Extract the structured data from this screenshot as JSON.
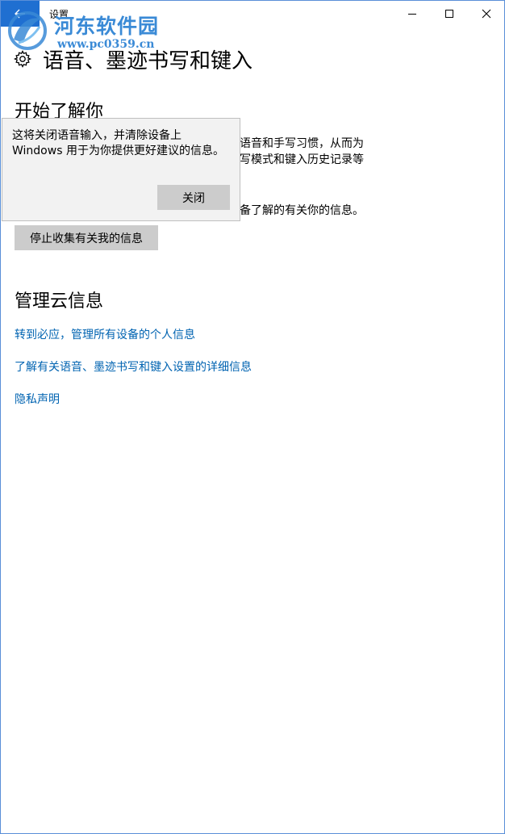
{
  "titlebar": {
    "app_title": "设置",
    "back_icon": "back-arrow-icon",
    "accent": "#1f6fd1"
  },
  "watermark": {
    "name": "河东软件园",
    "url": "www.pc0359.cn"
  },
  "page": {
    "title": "语音、墨迹书写和键入"
  },
  "getting_to_know": {
    "heading": "开始了解你",
    "text_line1": "语音和手写习惯，从而为",
    "text_line2": "写模式和键入历史记录等",
    "text_line3": "备了解的有关你的信息。",
    "stop_button": "停止收集有关我的信息"
  },
  "cloud": {
    "heading": "管理云信息",
    "links": [
      "转到必应，管理所有设备的个人信息",
      "了解有关语音、墨迹书写和键入设置的详细信息",
      "隐私声明"
    ],
    "link_color": "#0063b1"
  },
  "flyout": {
    "message": "这将关闭语音输入，并清除设备上 Windows 用于为你提供更好建议的信息。",
    "close_button": "关闭"
  }
}
